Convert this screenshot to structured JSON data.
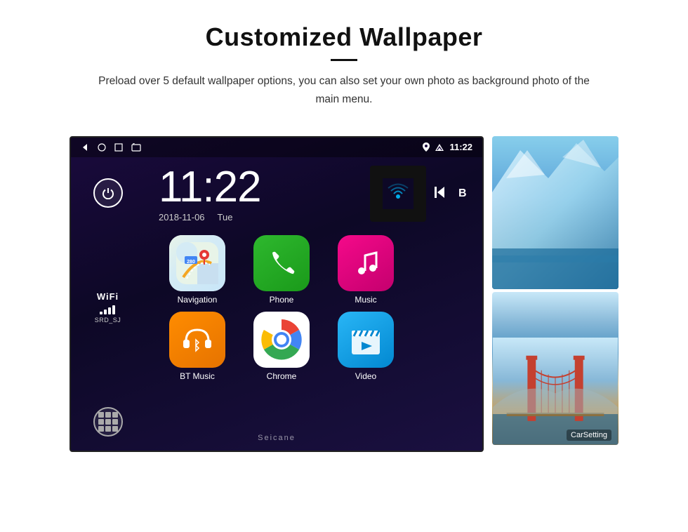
{
  "header": {
    "title": "Customized Wallpaper",
    "subtitle": "Preload over 5 default wallpaper options, you can also set your own photo as background photo of the main menu."
  },
  "android_screen": {
    "status_bar": {
      "time": "11:22",
      "nav_icons": [
        "back",
        "home",
        "recent",
        "screen"
      ]
    },
    "clock": {
      "time": "11:22",
      "date": "2018-11-06",
      "day": "Tue"
    },
    "wifi": {
      "label": "WiFi",
      "ssid": "SRD_SJ"
    },
    "apps": [
      {
        "name": "Navigation",
        "icon": "maps"
      },
      {
        "name": "Phone",
        "icon": "phone"
      },
      {
        "name": "Music",
        "icon": "music"
      },
      {
        "name": "BT Music",
        "icon": "btmusic"
      },
      {
        "name": "Chrome",
        "icon": "chrome"
      },
      {
        "name": "Video",
        "icon": "video"
      }
    ],
    "extra_app": "CarSetting",
    "watermark": "Seicane"
  }
}
